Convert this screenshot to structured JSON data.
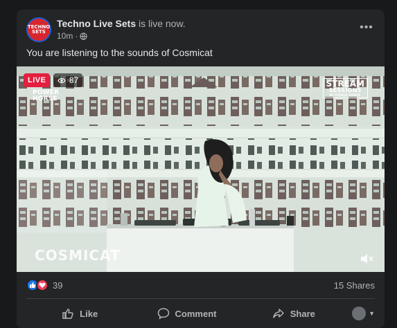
{
  "post": {
    "page_name": "Techno Live Sets",
    "status_text": " is live now.",
    "time": "10m",
    "separator": " · ",
    "avatar_text": "TECHNO SETS",
    "more_label": "•••",
    "text": "You are listening to the sounds of Cosmicat"
  },
  "video": {
    "live_label": "LIVE",
    "viewer_count": "87",
    "brand_left_line1": "POWER",
    "brand_left_line2": "HORSE",
    "brand_right_title": "STREAM",
    "brand_right_sub": "SESSIONS",
    "brand_right_by": "BY POWER HORSE",
    "artist": "COSMICAT"
  },
  "stats": {
    "reaction_count": "39",
    "shares": "15 Shares"
  },
  "actions": [
    {
      "label": "Like",
      "icon": "thumbs-up-icon"
    },
    {
      "label": "Comment",
      "icon": "comment-icon"
    },
    {
      "label": "Share",
      "icon": "share-icon"
    }
  ],
  "colors": {
    "background": "#18191a",
    "card": "#242526",
    "live_red": "#e41e3f",
    "like_blue": "#1877f2",
    "love_red": "#f33e58",
    "text_primary": "#e4e6eb",
    "text_secondary": "#b0b3b8"
  }
}
